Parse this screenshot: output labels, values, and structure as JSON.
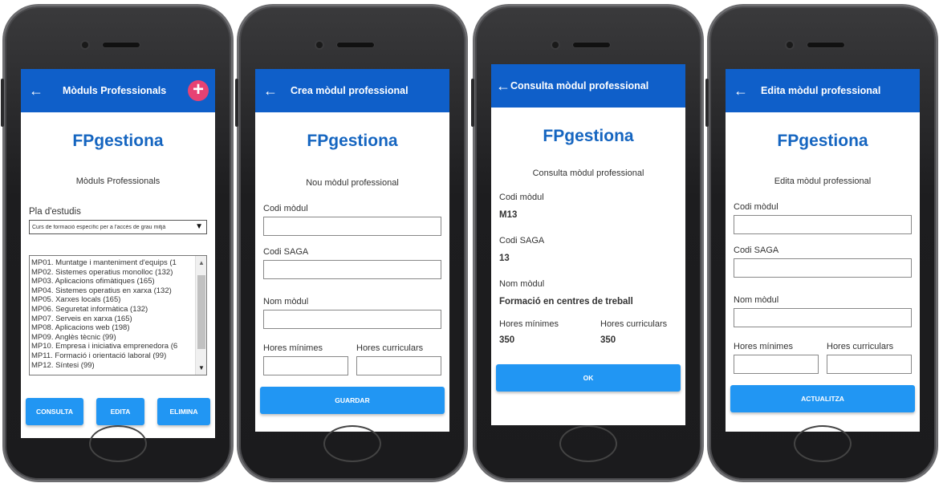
{
  "phones": [
    {
      "title": "Mòduls Professionals",
      "brand": "FPgestiona",
      "subtitle": "Mòduls Professionals",
      "plan_label": "Pla d'estudis",
      "plan_selected": "Curs de formació específic per a l'accés de grau mitjà",
      "modules": [
        "MP01. Muntatge i manteniment d'equips (1",
        "MP02. Sistemes operatius monolloc (132)",
        "MP03. Aplicacions ofimàtiques (165)",
        "MP04. Sistemes operatius en xarxa (132)",
        "MP05. Xarxes locals (165)",
        "MP06. Seguretat informàtica (132)",
        "MP07. Serveis en xarxa (165)",
        "MP08. Aplicacions web (198)",
        "MP09. Anglès tècnic (99)",
        "MP10. Empresa i iniciativa emprenedora (6",
        "MP11. Formació i orientació laboral (99)",
        "MP12. Síntesi (99)"
      ],
      "buttons": [
        "CONSULTA",
        "EDITA",
        "ELIMINA"
      ]
    },
    {
      "title": "Crea mòdul professional",
      "brand": "FPgestiona",
      "subtitle": "Nou mòdul professional",
      "labels": [
        "Codi mòdul",
        "Codi SAGA",
        "Nom mòdul",
        "Hores mínimes",
        "Hores curriculars"
      ],
      "button": "GUARDAR"
    },
    {
      "title": "Consulta mòdul professional",
      "brand": "FPgestiona",
      "subtitle": "Consulta mòdul professional",
      "labels": [
        "Codi mòdul",
        "Codi SAGA",
        "Nom mòdul",
        "Hores mínimes",
        "Hores curriculars"
      ],
      "values": [
        "M13",
        "13",
        "Formació en centres de treball",
        "350",
        "350"
      ],
      "button": "OK"
    },
    {
      "title": "Edita mòdul professional",
      "brand": "FPgestiona",
      "subtitle": "Edita mòdul professional",
      "labels": [
        "Codi mòdul",
        "Codi SAGA",
        "Nom mòdul",
        "Hores mínimes",
        "Hores curriculars"
      ],
      "button": "ACTUALITZA"
    }
  ],
  "icons": {
    "back": "←",
    "add": "+"
  },
  "colors": {
    "appbar": "#0f5fc9",
    "brand": "#1565c0",
    "button": "#2196f3",
    "add_button": "#e74273"
  }
}
